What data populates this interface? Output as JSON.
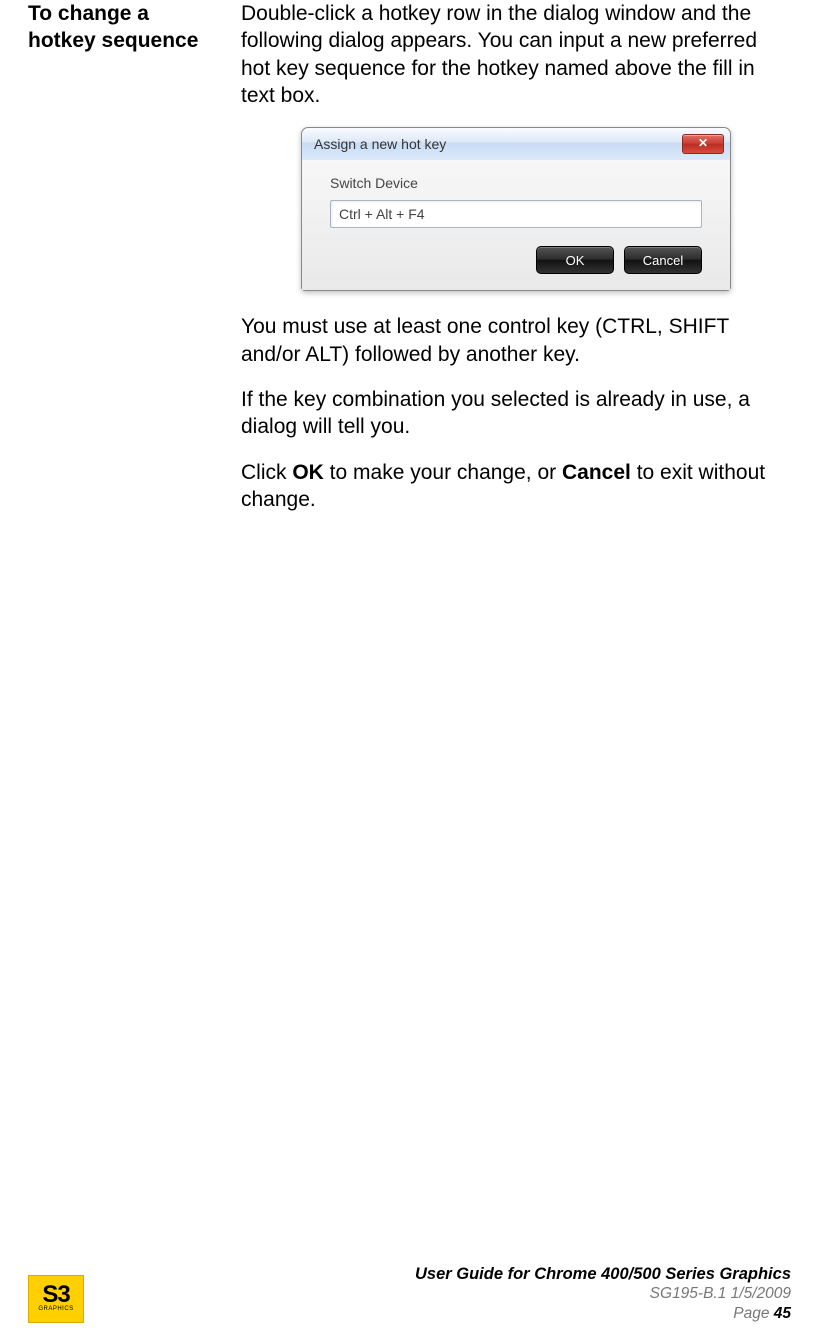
{
  "leftHeading": "To change a hotkey sequence",
  "para1": "Double-click a hotkey row in the dialog window and the following dialog appears. You can input a new preferred hot key sequence for the hotkey named above the fill in text box.",
  "para2": "You must use at least one control key (CTRL, SHIFT and/or ALT) followed by another key.",
  "para3": "If the key combination you selected is already in use, a dialog will tell you.",
  "para4_pre": "Click ",
  "para4_ok": "OK",
  "para4_mid": " to make your change, or ",
  "para4_cancel": "Cancel",
  "para4_post": " to exit without change.",
  "dialog": {
    "title": "Assign a new hot key",
    "closeGlyph": "✕",
    "fieldLabel": "Switch Device",
    "fieldValue": "Ctrl + Alt + F4",
    "okLabel": "OK",
    "cancelLabel": "Cancel"
  },
  "footer": {
    "logoMain": "S3",
    "logoSub": "GRAPHICS",
    "title": "User Guide for Chrome 400/500 Series Graphics",
    "docLine": "SG195-B.1   1/5/2009",
    "pageWord": "Page ",
    "pageNum": "45"
  }
}
